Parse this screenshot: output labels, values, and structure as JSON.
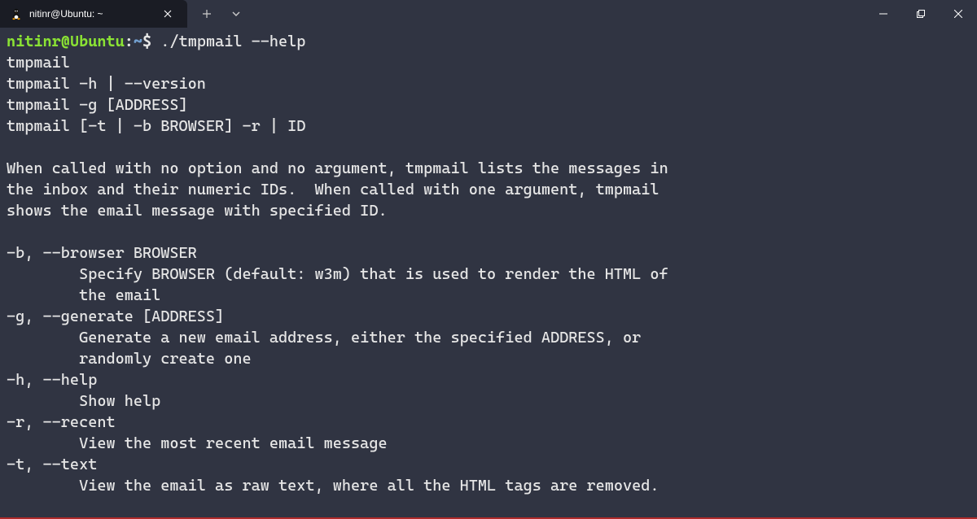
{
  "titlebar": {
    "tab_title": "nitinr@Ubuntu: ~",
    "tab_icon": "tux-icon"
  },
  "prompt": {
    "user": "nitinr",
    "host": "Ubuntu",
    "path": "~",
    "symbol": "$"
  },
  "command": "./tmpmail --help",
  "output_lines": [
    "tmpmail",
    "tmpmail -h | --version",
    "tmpmail -g [ADDRESS]",
    "tmpmail [-t | -b BROWSER] -r | ID",
    "",
    "When called with no option and no argument, tmpmail lists the messages in",
    "the inbox and their numeric IDs.  When called with one argument, tmpmail",
    "shows the email message with specified ID.",
    "",
    "-b, --browser BROWSER",
    "        Specify BROWSER (default: w3m) that is used to render the HTML of",
    "        the email",
    "-g, --generate [ADDRESS]",
    "        Generate a new email address, either the specified ADDRESS, or",
    "        randomly create one",
    "-h, --help",
    "        Show help",
    "-r, --recent",
    "        View the most recent email message",
    "-t, --text",
    "        View the email as raw text, where all the HTML tags are removed."
  ]
}
